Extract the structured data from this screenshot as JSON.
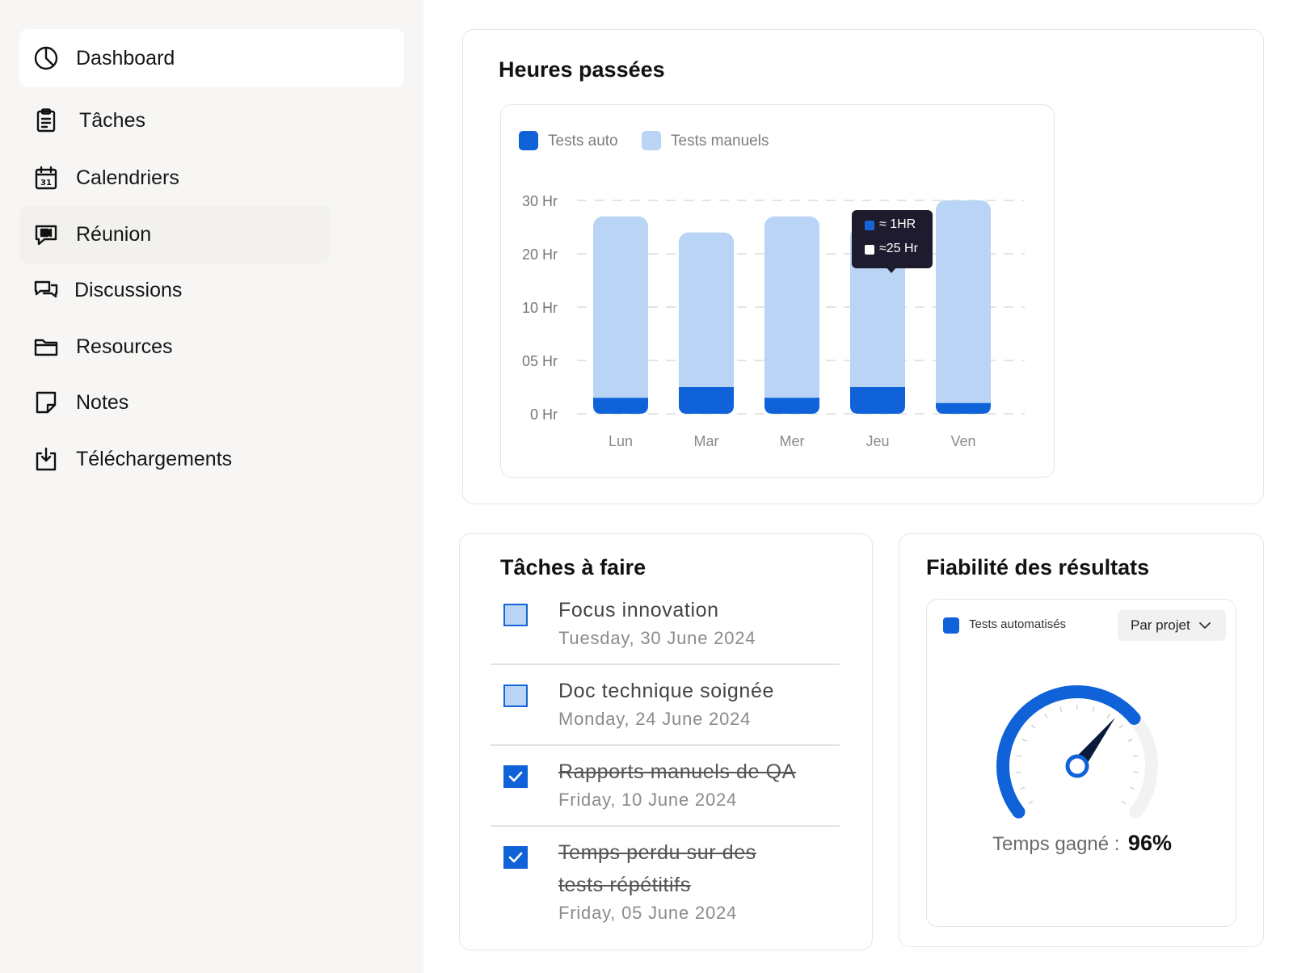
{
  "sidebar": {
    "items": [
      {
        "label": "Dashboard",
        "icon": "pie-chart-icon"
      },
      {
        "label": "Tâches",
        "icon": "clipboard-icon"
      },
      {
        "label": "Calendriers",
        "icon": "calendar-icon"
      },
      {
        "label": "Réunion",
        "icon": "chat-video-icon"
      },
      {
        "label": "Discussions",
        "icon": "chat-bubbles-icon"
      },
      {
        "label": "Resources",
        "icon": "folder-icon"
      },
      {
        "label": "Notes",
        "icon": "note-icon"
      },
      {
        "label": "Téléchargements",
        "icon": "download-icon"
      }
    ]
  },
  "hours_card": {
    "title": "Heures passées",
    "tooltip": {
      "auto": "≈ 1HR",
      "manual": "≈25 Hr"
    }
  },
  "tasks_card": {
    "title": "Tâches à faire",
    "tasks": [
      {
        "title": "Focus innovation",
        "date": "Tuesday, 30 June 2024",
        "done": false
      },
      {
        "title": "Doc technique soignée",
        "date": "Monday, 24 June 2024",
        "done": false
      },
      {
        "title": "Rapports manuels de QA",
        "date": "Friday, 10 June 2024",
        "done": true
      },
      {
        "title_line1": "Temps perdu sur des",
        "title_line2": "tests répétitifs",
        "date": "Friday, 05 June 2024",
        "done": true
      }
    ]
  },
  "reliability_card": {
    "title": "Fiabilité des résultats",
    "legend": "Tests automatisés",
    "dropdown": "Par projet",
    "gauge_label": "Temps gagné :",
    "gauge_value": "96%",
    "gauge_fraction": 0.96
  },
  "colors": {
    "auto": "#0f62d8",
    "manual": "#b9d4f4",
    "tooltip_bg": "#1e1b2e"
  },
  "chart_data": {
    "type": "bar",
    "stacked": true,
    "categories": [
      "Lun",
      "Mar",
      "Mer",
      "Jeu",
      "Ven"
    ],
    "series": [
      {
        "name": "Tests auto",
        "values": [
          1.5,
          2.5,
          1.5,
          2.5,
          1
        ]
      },
      {
        "name": "Tests manuels",
        "values": [
          25.5,
          21.5,
          25.5,
          22.5,
          29.5
        ]
      }
    ],
    "y_ticks": [
      "0 Hr",
      "05 Hr",
      "10 Hr",
      "20 Hr",
      "30 Hr"
    ],
    "ylim": [
      0,
      30
    ],
    "grid": true,
    "legend_position": "top-left"
  }
}
